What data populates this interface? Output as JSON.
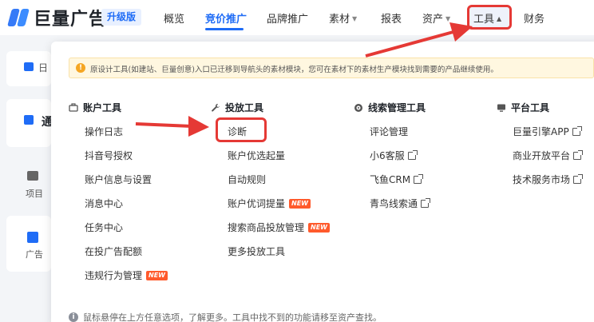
{
  "header": {
    "logo_text": "巨量广告",
    "upgrade_badge": "升级版",
    "nav": [
      {
        "label": "概览"
      },
      {
        "label": "竞价推广"
      },
      {
        "label": "品牌推广"
      },
      {
        "label": "素材"
      },
      {
        "label": "报表"
      },
      {
        "label": "资产"
      },
      {
        "label": "工具"
      },
      {
        "label": "财务"
      }
    ]
  },
  "sidebar": {
    "items": [
      {
        "label": "日"
      },
      {
        "label": "通"
      },
      {
        "label": "项目"
      },
      {
        "label": "广告"
      }
    ]
  },
  "notice": {
    "text": "原设计工具(如建站、巨量创意)入口已迁移到导航头的素材模块，您可在素材下的素材生产模块找到需要的产品继续使用。"
  },
  "columns": [
    {
      "title": "账户工具",
      "items": [
        {
          "label": "操作日志"
        },
        {
          "label": "抖音号授权"
        },
        {
          "label": "账户信息与设置"
        },
        {
          "label": "消息中心"
        },
        {
          "label": "任务中心"
        },
        {
          "label": "在投广告配额"
        },
        {
          "label": "违规行为管理",
          "badge": "NEW"
        }
      ]
    },
    {
      "title": "投放工具",
      "items": [
        {
          "label": "诊断"
        },
        {
          "label": "账户优选起量"
        },
        {
          "label": "自动规则"
        },
        {
          "label": "账户优词提量",
          "badge": "NEW"
        },
        {
          "label": "搜索商品投放管理",
          "badge": "NEW"
        },
        {
          "label": "更多投放工具"
        }
      ]
    },
    {
      "title": "线索管理工具",
      "items": [
        {
          "label": "评论管理"
        },
        {
          "label": "小6客服"
        },
        {
          "label": "飞鱼CRM"
        },
        {
          "label": "青鸟线索通"
        }
      ]
    },
    {
      "title": "平台工具",
      "items": [
        {
          "label": "巨量引擎APP"
        },
        {
          "label": "商业开放平台"
        },
        {
          "label": "技术服务市场"
        }
      ]
    }
  ],
  "footer": {
    "text": "鼠标悬停在上方任意选项，了解更多。工具中找不到的功能请移至资产查找。"
  },
  "colors": {
    "accent": "#1f6cf6",
    "highlight_red": "#e53935",
    "new_badge": "#ff5a2c"
  },
  "icons": [
    "logo-mark",
    "caret-down-icon",
    "caret-up-icon",
    "info-icon",
    "external-link-icon",
    "briefcase-icon",
    "wrench-icon",
    "target-icon",
    "monitor-icon",
    "arrow-annotation"
  ]
}
